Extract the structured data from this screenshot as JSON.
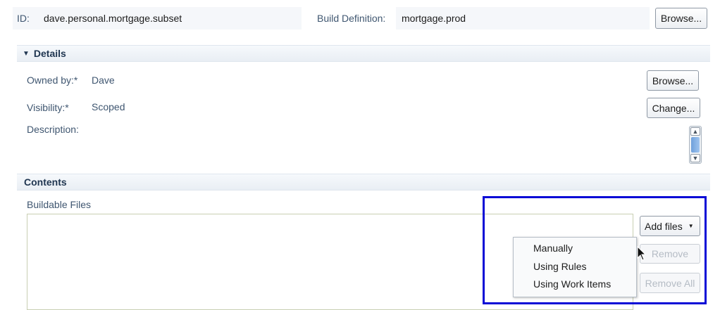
{
  "header": {
    "id_label": "ID:",
    "id_value": "dave.personal.mortgage.subset",
    "build_def_label": "Build Definition:",
    "build_def_value": "mortgage.prod",
    "browse_label": "Browse..."
  },
  "details": {
    "title": "Details",
    "owned_by_label": "Owned by:*",
    "owned_by_value": "Dave",
    "owned_browse_label": "Browse...",
    "visibility_label": "Visibility:*",
    "visibility_value": "Scoped",
    "change_label": "Change...",
    "description_label": "Description:"
  },
  "contents": {
    "title": "Contents",
    "buildable_files_label": "Buildable Files",
    "add_files_label": "Add files",
    "remove_label": "Remove",
    "remove_all_label": "Remove All",
    "menu_items": [
      "Manually",
      "Using Rules",
      "Using Work Items"
    ]
  },
  "colors": {
    "highlight_border": "#0a0ad6",
    "section_header": "#e9eef4"
  }
}
